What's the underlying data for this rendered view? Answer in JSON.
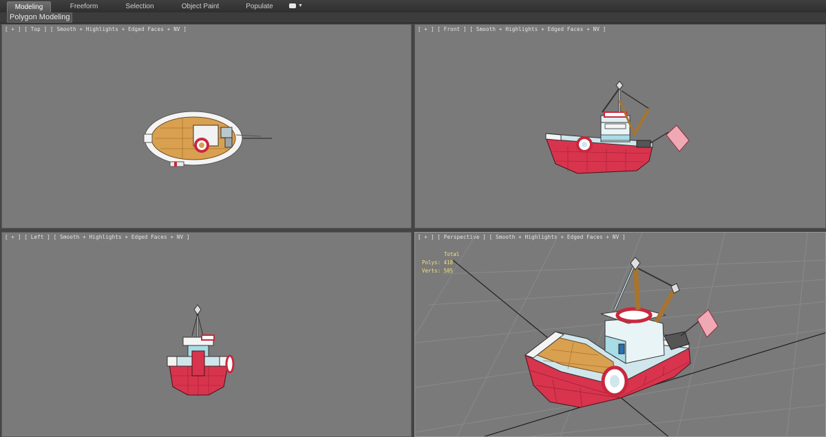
{
  "ribbon": {
    "tabs": [
      {
        "label": "Modeling"
      },
      {
        "label": "Freeform"
      },
      {
        "label": "Selection"
      },
      {
        "label": "Object Paint"
      },
      {
        "label": "Populate"
      }
    ]
  },
  "subbar": {
    "label": "Polygon Modeling"
  },
  "viewports": {
    "top": {
      "label": "[ + ] [ Top ] [ Smooth + Highlights + Edged Faces + NV ]"
    },
    "front": {
      "label": "[ + ] [ Front ] [ Smooth + Highlights + Edged Faces + NV ]"
    },
    "left": {
      "label": "[ + ] [ Left ] [ Smooth + Highlights + Edged Faces + NV ]"
    },
    "persp": {
      "label": "[ + ] [ Perspective ] [ Smooth + Highlights + Edged Faces + NV ]"
    }
  },
  "stats": {
    "total": "Total",
    "polys": "Polys: 418",
    "verts": "Verts: 505"
  },
  "colors": {
    "hull_red": "#d8344e",
    "deck_wood": "#d9a050",
    "trim_white": "#f2f2f2",
    "cabin_blue": "#a8dce6",
    "viewport_bg": "#7a7a7a"
  }
}
